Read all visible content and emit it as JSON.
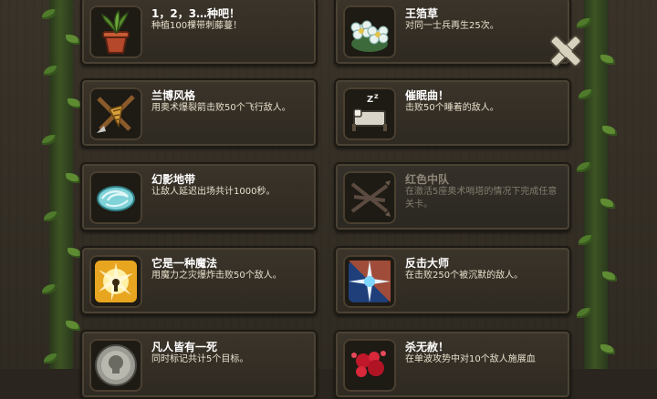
{
  "achievements": [
    {
      "title": "1，2，3…种吧！",
      "desc": "种植100棵带刺藤蔓！",
      "locked": false,
      "icon": "potted-plant-icon"
    },
    {
      "title": "王箔草",
      "desc": "对同一士兵再生25次。",
      "locked": false,
      "icon": "flowers-icon"
    },
    {
      "title": "兰博风格",
      "desc": "用奥术爆裂箭击败50个飞行敌人。",
      "locked": false,
      "icon": "arrow-drill-icon"
    },
    {
      "title": "催眠曲！",
      "desc": "击败50个睡着的敌人。",
      "locked": false,
      "icon": "sleeping-bed-icon"
    },
    {
      "title": "幻影地带",
      "desc": "让敌人延迟出场共计1000秒。",
      "locked": false,
      "icon": "phantom-swirl-icon"
    },
    {
      "title": "红色中队",
      "desc": "在激活5座奥术哨塔的情况下完成任意关卡。",
      "locked": true,
      "icon": "crossed-arrows-icon"
    },
    {
      "title": "它是一种魔法",
      "desc": "用魔力之灾爆炸击败50个敌人。",
      "locked": false,
      "icon": "magic-explosion-icon"
    },
    {
      "title": "反击大师",
      "desc": "在击败250个被沉默的敌人。",
      "locked": false,
      "icon": "counter-strike-icon"
    },
    {
      "title": "凡人皆有一死",
      "desc": "同时标记共计5个目标。",
      "locked": false,
      "icon": "skull-coin-icon"
    },
    {
      "title": "杀无赦！",
      "desc": "在单波攻势中对10个敌人施展血",
      "locked": false,
      "icon": "blood-splatter-icon"
    }
  ],
  "close_icon": "close-x-icon",
  "colors": {
    "title": "#ffffff",
    "desc": "#e8e0cc",
    "locked_text": "#8e8778",
    "card": "#35302a",
    "vine": "#4f7a2b"
  }
}
